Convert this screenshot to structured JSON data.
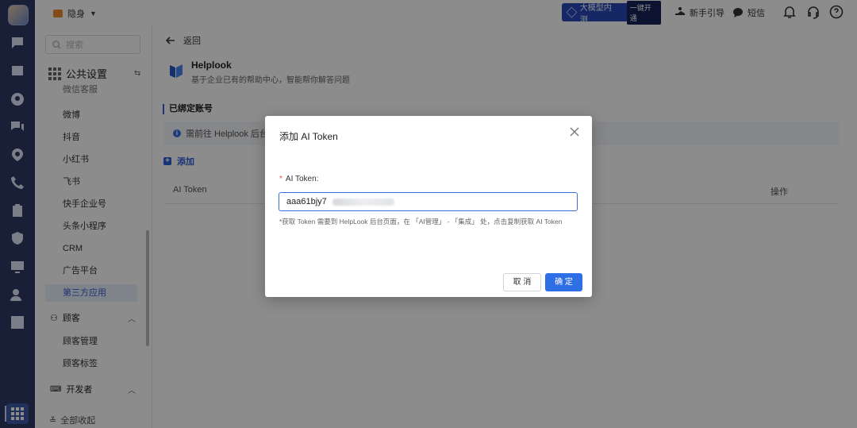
{
  "topbar": {
    "status_label": "隐身",
    "llm_label": "大模型内测",
    "llm_open": "一键开通",
    "guide_label": "新手引导",
    "sms_label": "短信"
  },
  "sidebar": {
    "search_placeholder": "搜索",
    "group_public": "公共设置",
    "items": [
      {
        "label": "微信客服"
      },
      {
        "label": "微博"
      },
      {
        "label": "抖音"
      },
      {
        "label": "小红书"
      },
      {
        "label": "飞书"
      },
      {
        "label": "快手企业号"
      },
      {
        "label": "头条小程序"
      },
      {
        "label": "CRM"
      },
      {
        "label": "广告平台"
      },
      {
        "label": "第三方应用"
      }
    ],
    "group_customer": "顾客",
    "customer_items": [
      {
        "label": "顾客管理"
      },
      {
        "label": "顾客标签"
      }
    ],
    "group_dev": "开发者",
    "collapse_all": "全部收起"
  },
  "main": {
    "back_label": "返回",
    "app_name": "Helplook",
    "app_desc": "基于企业已有的帮助中心，智能帮你解答问题",
    "section_title": "已绑定账号",
    "notice_text": "需前往 Helplook 后台",
    "add_label": "添加",
    "table_columns": [
      "AI Token",
      "操作"
    ]
  },
  "dialog": {
    "title": "添加 AI Token",
    "field_label": "AI Token:",
    "required_mark": "*",
    "token_value": "aaa61bjy7",
    "hint": "*获取 Token 需要到 HelpLook 后台页面，在 「AI管理」 - 「集成」 处，点击复制获取 AI Token",
    "cancel_label": "取 消",
    "ok_label": "确 定"
  },
  "colors": {
    "rail_bg": "#2c3a63",
    "primary": "#2f6fe6",
    "active_item_bg": "#e8eefb",
    "required": "#e34d4d"
  }
}
